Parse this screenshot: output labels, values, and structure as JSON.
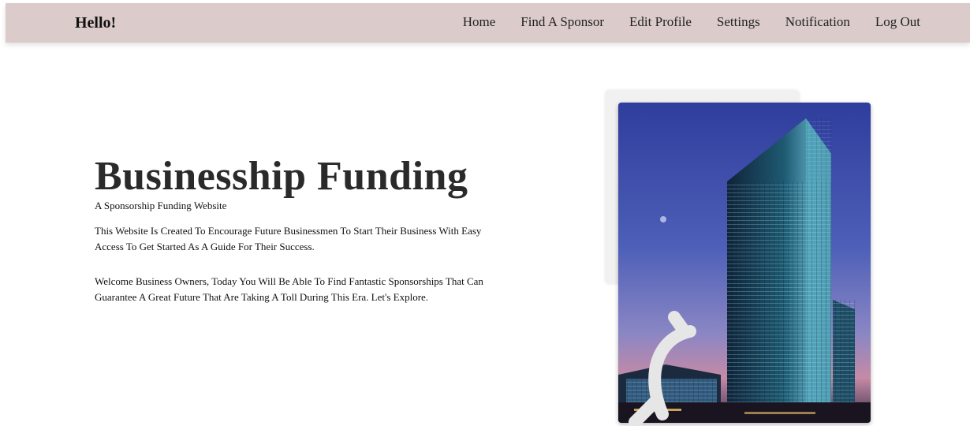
{
  "navbar": {
    "brand": "Hello!",
    "links": [
      {
        "label": "Home"
      },
      {
        "label": "Find A Sponsor"
      },
      {
        "label": "Edit Profile"
      },
      {
        "label": "Settings"
      },
      {
        "label": "Notification"
      },
      {
        "label": "Log Out"
      }
    ],
    "background": "#dccbcb"
  },
  "hero": {
    "title": "Businesship Funding",
    "subtitle": "A Sponsorship Funding Website",
    "paragraph1": "This Website Is Created To Encourage Future Businessmen To Start Their Business With Easy Access To Get Started As A Guide For Their Success.",
    "paragraph2": "Welcome Business Owners, Today You Will Be Able To Find Fantastic Sponsorships That Can Guarantee A Great Future That Are Taking A Toll During This Era. Let's Explore."
  },
  "image": {
    "subject": "skyscraper-at-dusk"
  }
}
